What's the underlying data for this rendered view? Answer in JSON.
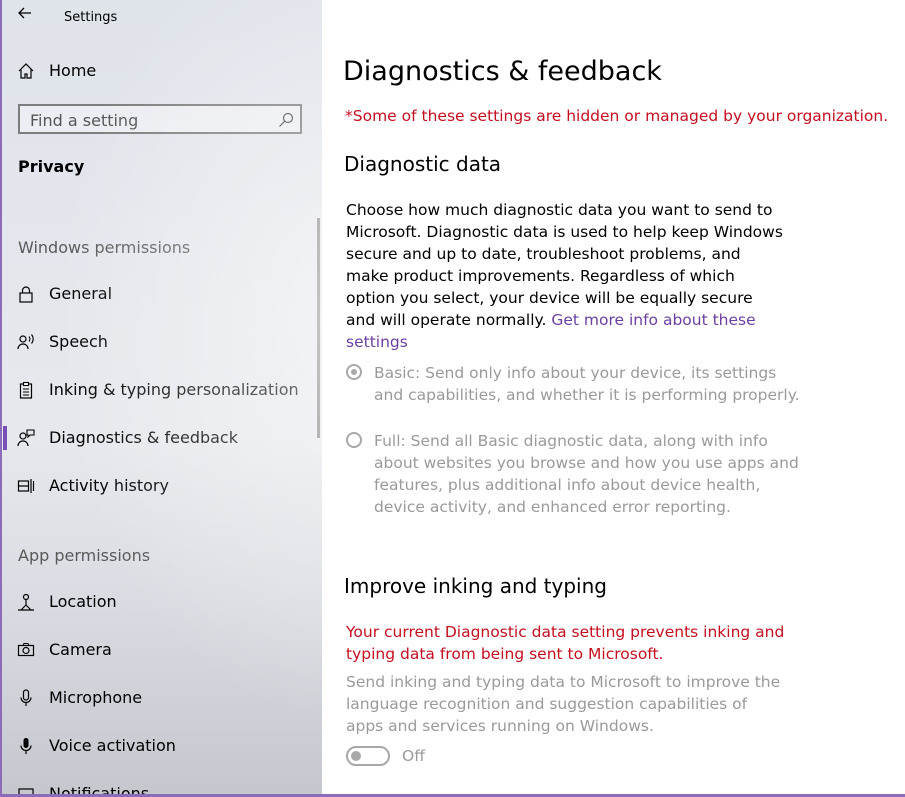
{
  "window": {
    "title": "Settings"
  },
  "sidebar": {
    "home": "Home",
    "search_placeholder": "Find a setting",
    "category": "Privacy",
    "windows_permissions_header": "Windows permissions",
    "windows_permissions": [
      {
        "label": "General",
        "icon": "lock-icon"
      },
      {
        "label": "Speech",
        "icon": "speech-icon"
      },
      {
        "label": "Inking & typing personalization",
        "icon": "clipboard-icon"
      },
      {
        "label": "Diagnostics & feedback",
        "icon": "feedback-person-icon",
        "active": true
      },
      {
        "label": "Activity history",
        "icon": "timeline-icon"
      }
    ],
    "app_permissions_header": "App permissions",
    "app_permissions": [
      {
        "label": "Location",
        "icon": "location-person-icon"
      },
      {
        "label": "Camera",
        "icon": "camera-icon"
      },
      {
        "label": "Microphone",
        "icon": "microphone-icon"
      },
      {
        "label": "Voice activation",
        "icon": "voice-activation-icon"
      },
      {
        "label": "Notifications",
        "icon": "notifications-icon"
      }
    ]
  },
  "main": {
    "title": "Diagnostics & feedback",
    "managed_warning": "*Some of these settings are hidden or managed by your organization.",
    "diagnostic_data": {
      "heading": "Diagnostic data",
      "description": "Choose how much diagnostic data you want to send to Microsoft. Diagnostic data is used to help keep Windows secure and up to date, troubleshoot problems, and make product improvements. Regardless of which option you select, your device will be equally secure and will operate normally.",
      "link": "Get more info about these settings",
      "options": [
        {
          "label": "Basic: Send only info about your device, its settings and capabilities, and whether it is performing properly.",
          "selected": true
        },
        {
          "label": "Full: Send all Basic diagnostic data, along with info about websites you browse and how you use apps and features, plus additional info about device health, device activity, and enhanced error reporting.",
          "selected": false
        }
      ]
    },
    "inking": {
      "heading": "Improve inking and typing",
      "warning": "Your current Diagnostic data setting prevents inking and typing data from being sent to Microsoft.",
      "description": "Send inking and typing data to Microsoft to improve the language recognition and suggestion capabilities of apps and services running on Windows.",
      "toggle_state": "Off"
    }
  },
  "colors": {
    "accent": "#7a4fb5",
    "warning": "#c50f1f",
    "link": "#6b3fa0",
    "disabled": "#9a9a9a"
  }
}
